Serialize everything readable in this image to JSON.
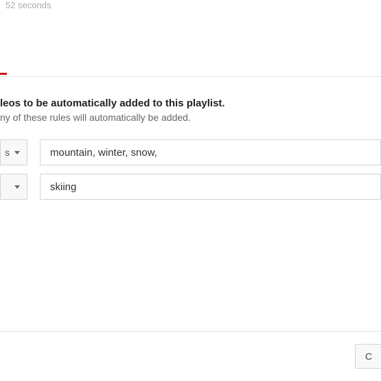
{
  "top_status": {
    "fragment": "52 seconds"
  },
  "heading_text": "leos to be automatically added to this playlist.",
  "subheading_text": "ny of these rules will automatically be added.",
  "rules": [
    {
      "dropdown_label": "s",
      "input_value": "mountain, winter, snow,"
    },
    {
      "dropdown_label": "",
      "input_value": "skiing"
    }
  ],
  "footer_button_fragment": "C"
}
